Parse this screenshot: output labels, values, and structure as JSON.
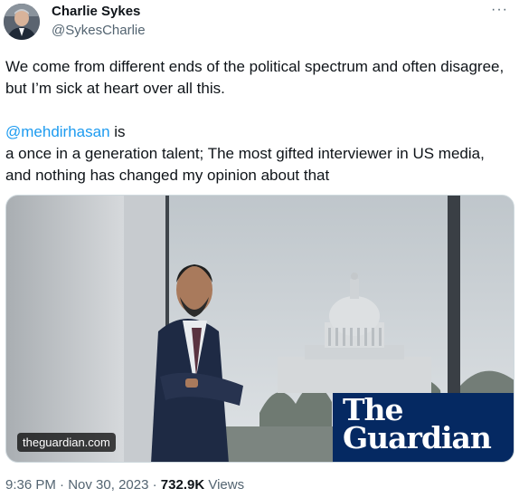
{
  "author": {
    "display_name": "Charlie Sykes",
    "handle": "@SykesCharlie"
  },
  "more_icon": "more-horizontal-icon",
  "tweet": {
    "line1": "We come from different ends  of the political spectrum and often disagree, but I’m sick at heart over all this.",
    "mention": "@mehdirhasan",
    "after_mention": " is",
    "line3": "a once in a generation talent; The most gifted interviewer in US media, and nothing has changed my opinion about that"
  },
  "media": {
    "source": "theguardian.com",
    "logo_the": "The",
    "logo_name": "Guardian",
    "logo_bg": "#052962"
  },
  "meta": {
    "time": "9:36 PM",
    "date": "Nov 30, 2023",
    "views_count": "732.9K",
    "views_label": "Views",
    "sep": "·"
  },
  "colors": {
    "link": "#1d9bf0",
    "secondary_text": "#536471",
    "primary_text": "#0f1419"
  }
}
